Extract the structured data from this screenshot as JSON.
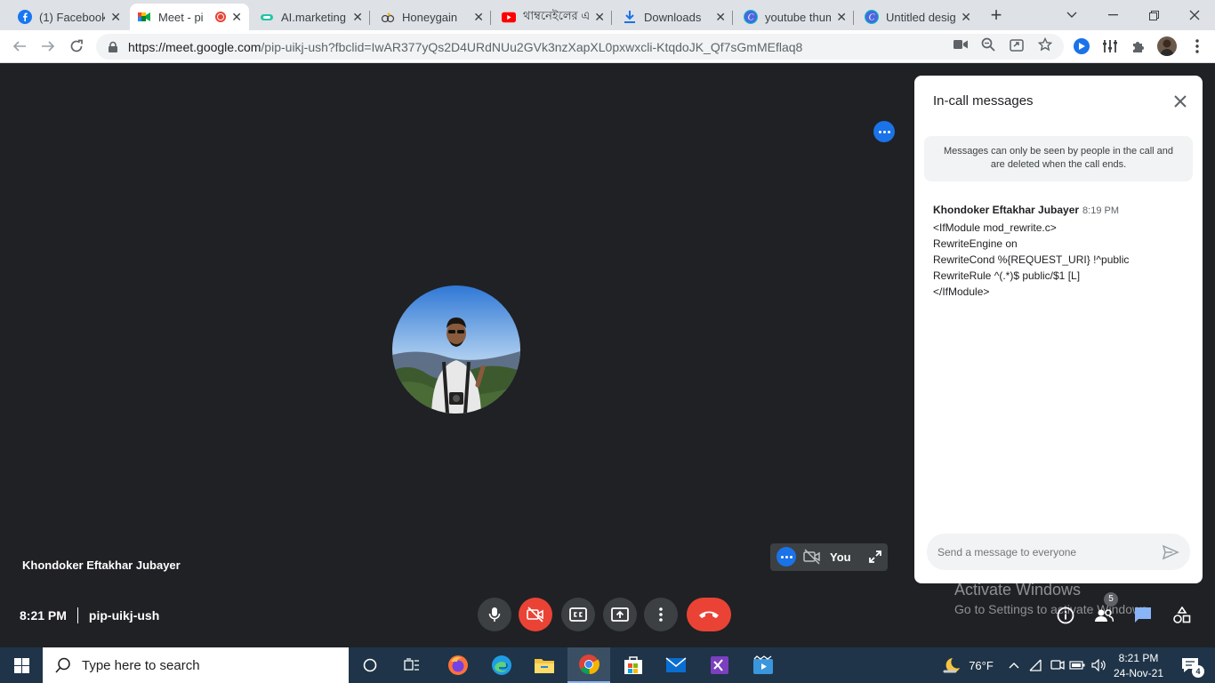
{
  "browser": {
    "tabs": [
      {
        "label": "(1) Facebook",
        "icon": "facebook-icon"
      },
      {
        "label": "Meet - pi",
        "icon": "google-meet-icon",
        "recording": true
      },
      {
        "label": "AI.marketing",
        "icon": "ai-marketing-icon"
      },
      {
        "label": "Honeygain",
        "icon": "honeygain-icon"
      },
      {
        "label": "থাম্বনেইলের এই",
        "icon": "youtube-icon"
      },
      {
        "label": "Downloads",
        "icon": "download-icon"
      },
      {
        "label": "youtube thum",
        "icon": "canva-icon"
      },
      {
        "label": "Untitled desig",
        "icon": "canva-icon"
      }
    ],
    "url_host": "https://meet.google.com",
    "url_path": "/pip-uikj-ush?fbclid=IwAR377yQs2D4URdNUu2GVk3nzXapXL0pxwxcli-KtqdoJK_Qf7sGmMEflaq8"
  },
  "meet": {
    "participant_name": "Khondoker Eftakhar Jubayer",
    "self_label": "You",
    "time": "8:21 PM",
    "meeting_code": "pip-uikj-ush",
    "people_count": "5",
    "watermark_title": "Activate Windows",
    "watermark_sub": "Go to Settings to activate Windows."
  },
  "chat": {
    "title": "In-call messages",
    "notice": "Messages can only be seen by people in the call and are deleted when the call ends.",
    "message": {
      "sender": "Khondoker Eftakhar Jubayer",
      "time": "8:19 PM",
      "lines": [
        "<IfModule mod_rewrite.c>",
        "RewriteEngine on",
        "RewriteCond %{REQUEST_URI} !^public",
        "RewriteRule ^(.*)$ public/$1 [L]",
        "</IfModule>"
      ]
    },
    "input_placeholder": "Send a message to everyone"
  },
  "taskbar": {
    "search_placeholder": "Type here to search",
    "weather": "76°F",
    "clock_time": "8:21 PM",
    "clock_date": "24-Nov-21",
    "notification_count": "4"
  },
  "colors": {
    "meet_bg": "#202124",
    "accent_blue": "#1a73e8",
    "danger_red": "#ea4335",
    "taskbar": "#1f3448"
  }
}
